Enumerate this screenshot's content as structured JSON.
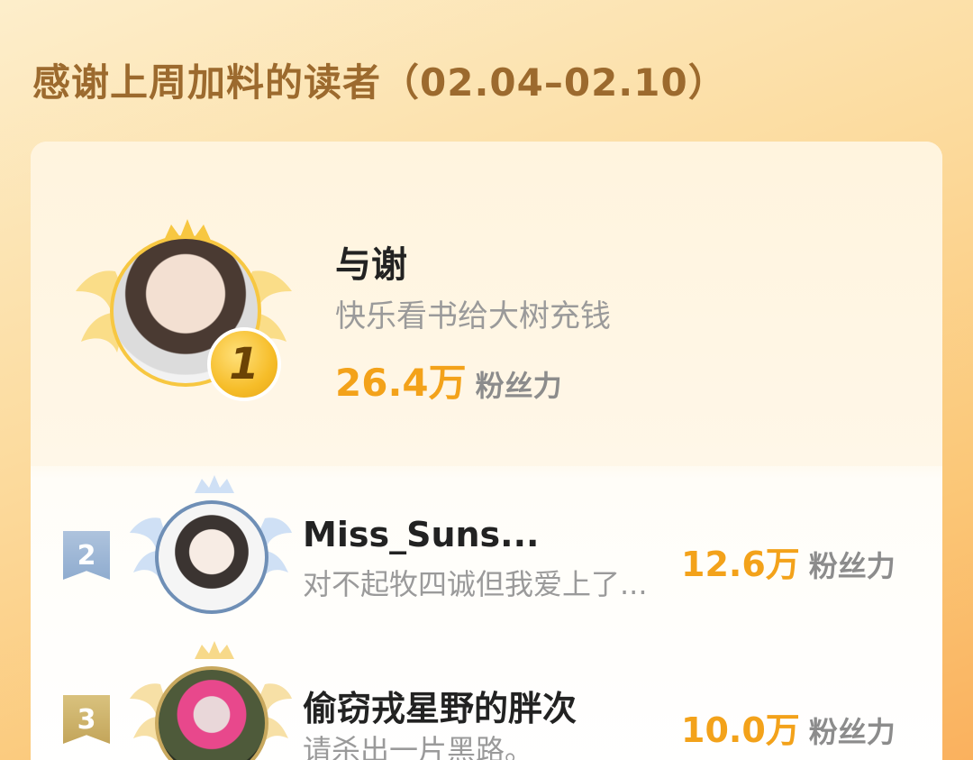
{
  "title": "感谢上周加料的读者（02.04–02.10）",
  "colors": {
    "accent": "#f3a21a",
    "title": "#9c6a2e",
    "gold_medal": "#f6bd29",
    "silver": "#8faccf",
    "bronze": "#c3a55a"
  },
  "score_unit": "粉丝力",
  "readers": [
    {
      "rank": "1",
      "name": "与谢",
      "motto": "快乐看书给大树充钱",
      "score": "26.4万",
      "score_unit": "粉丝力",
      "icons": [
        "crown-icon",
        "wings-icon",
        "gold-medal-icon"
      ]
    },
    {
      "rank": "2",
      "name": "Miss_Suns...",
      "motto": "对不起牧四诚但我爱上了...",
      "score": "12.6万",
      "score_unit": "粉丝力",
      "icons": [
        "crown-icon",
        "wings-icon",
        "silver-rank-badge-icon"
      ]
    },
    {
      "rank": "3",
      "name": "偷窃戎星野的胖次",
      "motto": "请杀出一片黑路。",
      "score": "10.0万",
      "score_unit": "粉丝力",
      "icons": [
        "crown-icon",
        "wings-icon",
        "bronze-rank-badge-icon"
      ]
    }
  ]
}
